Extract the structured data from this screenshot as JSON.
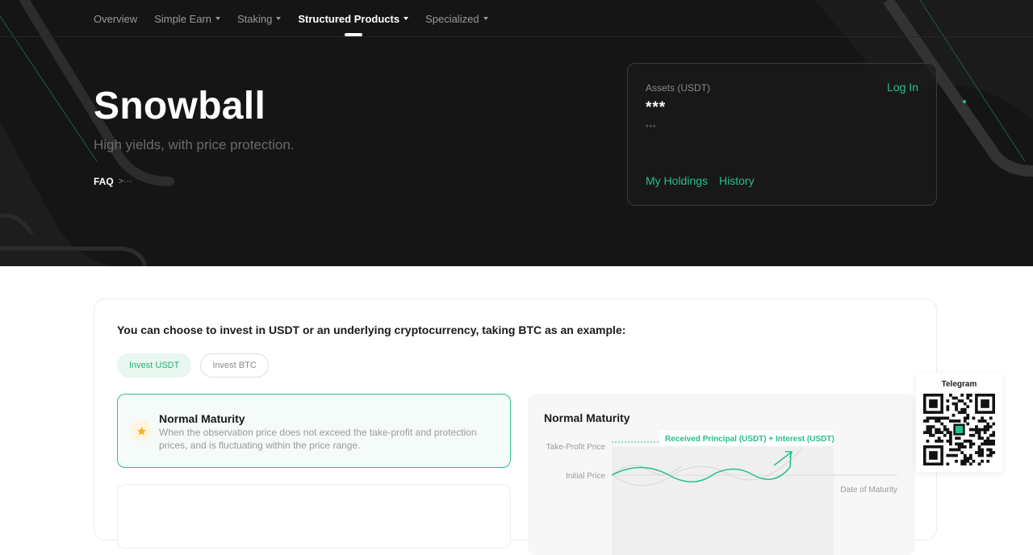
{
  "nav": {
    "items": [
      {
        "label": "Overview",
        "dropdown": false,
        "active": false
      },
      {
        "label": "Simple Earn",
        "dropdown": true,
        "active": false
      },
      {
        "label": "Staking",
        "dropdown": true,
        "active": false
      },
      {
        "label": "Structured Products",
        "dropdown": true,
        "active": true
      },
      {
        "label": "Specialized",
        "dropdown": true,
        "active": false
      }
    ]
  },
  "hero": {
    "title": "Snowball",
    "subtitle": "High yields, with price protection.",
    "faq_label": "FAQ",
    "faq_arrow": ">···"
  },
  "assets": {
    "label": "Assets (USDT)",
    "value": "***",
    "sub_value": "***",
    "login_label": "Log In",
    "holdings_label": "My Holdings",
    "history_label": "History"
  },
  "content": {
    "heading": "You can choose to invest in USDT or an underlying cryptocurrency, taking BTC as an example:",
    "tabs": [
      {
        "label": "Invest USDT",
        "active": true
      },
      {
        "label": "Invest BTC",
        "active": false
      }
    ],
    "option": {
      "title": "Normal Maturity",
      "description": "When the observation price does not exceed the take-profit and protection prices, and is fluctuating within the price range."
    }
  },
  "chart": {
    "title": "Normal Maturity",
    "take_profit_label": "Take-Profit Price",
    "initial_price_label": "Initial Price",
    "maturity_label": "Date of Maturity",
    "callout_label": "Received Principal (USDT) + Interest (USDT)"
  },
  "telegram": {
    "label": "Telegram"
  },
  "colors": {
    "accent": "#24c08a",
    "hero_bg": "#151515",
    "star": "#f5b21f"
  }
}
